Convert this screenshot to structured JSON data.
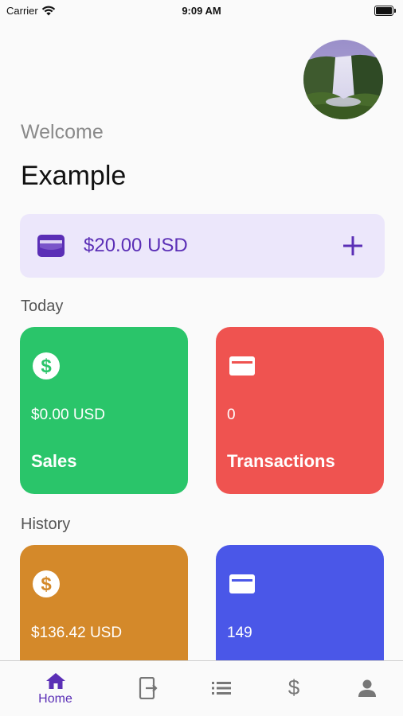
{
  "status_bar": {
    "carrier": "Carrier",
    "time": "9:09 AM"
  },
  "greeting": {
    "welcome": "Welcome",
    "name": "Example"
  },
  "balance": {
    "amount": "$20.00 USD"
  },
  "sections": {
    "today": "Today",
    "history": "History"
  },
  "today_tiles": [
    {
      "value": "$0.00 USD",
      "label": "Sales",
      "icon": "dollar-circle-icon",
      "color": "#2ac56a"
    },
    {
      "value": "0",
      "label": "Transactions",
      "icon": "credit-card-icon",
      "color": "#ef5350"
    }
  ],
  "history_tiles": [
    {
      "value": "$136.42 USD",
      "label": "",
      "icon": "dollar-circle-icon",
      "color": "#d4892a"
    },
    {
      "value": "149",
      "label": "",
      "icon": "credit-card-icon",
      "color": "#4a57e8"
    }
  ],
  "bottom_nav": [
    {
      "label": "Home",
      "icon": "home-icon",
      "active": true
    },
    {
      "label": "",
      "icon": "exit-to-app-icon",
      "active": false
    },
    {
      "label": "",
      "icon": "list-icon",
      "active": false
    },
    {
      "label": "",
      "icon": "dollar-icon",
      "active": false
    },
    {
      "label": "",
      "icon": "person-icon",
      "active": false
    }
  ],
  "colors": {
    "accent": "#5b2fb6",
    "balance_bg": "#ece7fb"
  }
}
